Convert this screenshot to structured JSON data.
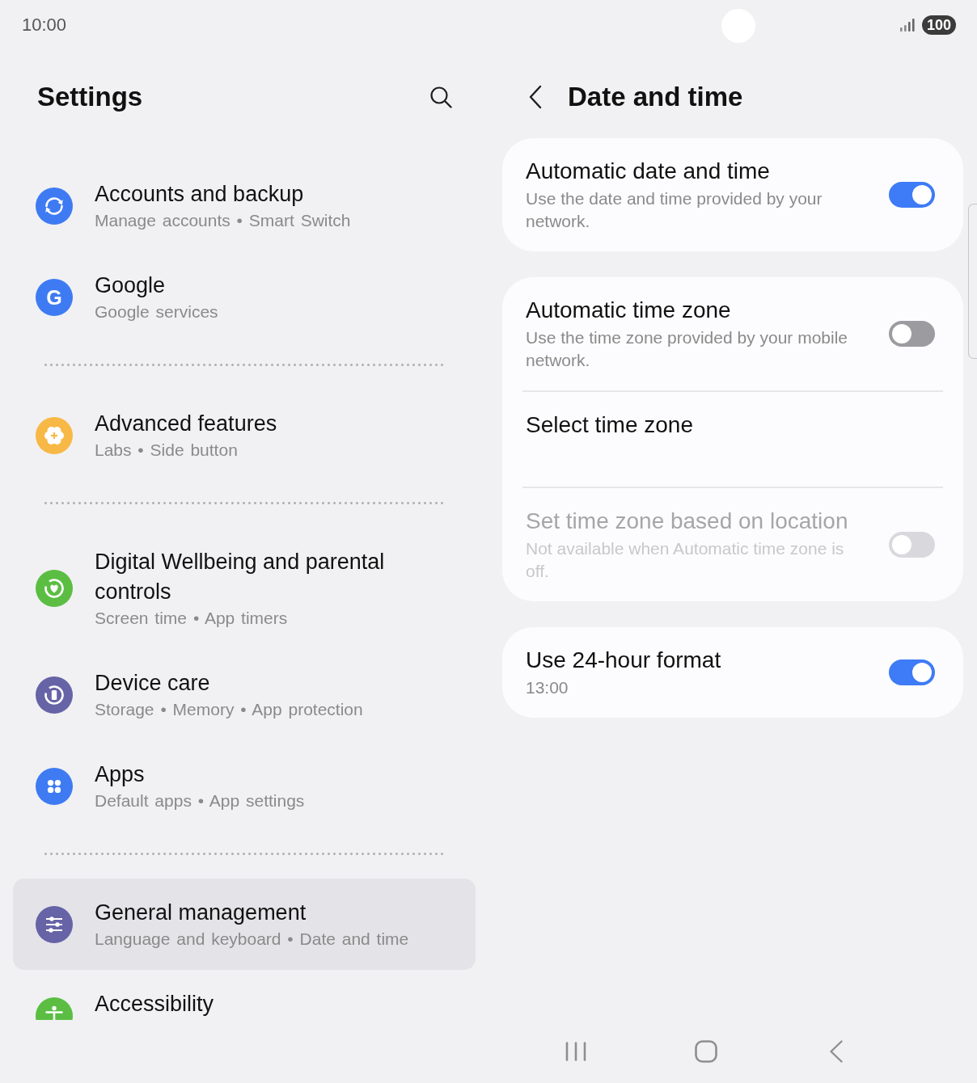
{
  "status_bar": {
    "time": "10:00",
    "battery": "100"
  },
  "settings_pane": {
    "title": "Settings",
    "groups": [
      {
        "items": [
          {
            "kind": "sync",
            "color": "#3e7bf3",
            "title": "Accounts and backup",
            "subtitle": "Manage accounts • Smart Switch",
            "selected": false
          },
          {
            "kind": "letter",
            "letter": "G",
            "color": "#3e7bf3",
            "title": "Google",
            "subtitle": "Google services",
            "selected": false
          }
        ]
      },
      {
        "items": [
          {
            "kind": "gear",
            "color": "#f8b846",
            "title": "Advanced features",
            "subtitle": "Labs • Side button",
            "selected": false
          }
        ]
      },
      {
        "items": [
          {
            "kind": "heart",
            "color": "#5bbe43",
            "title": "Digital Wellbeing and parental controls",
            "subtitle": "Screen time • App timers",
            "selected": false
          },
          {
            "kind": "phone",
            "color": "#6663a6",
            "title": "Device care",
            "subtitle": "Storage • Memory • App protection",
            "selected": false
          },
          {
            "kind": "dots",
            "color": "#3e7bf3",
            "title": "Apps",
            "subtitle": "Default apps • App settings",
            "selected": false
          }
        ]
      },
      {
        "items": [
          {
            "kind": "sliders",
            "color": "#6663a6",
            "title": "General management",
            "subtitle": "Language and keyboard • Date and time",
            "selected": true
          },
          {
            "kind": "person",
            "color": "#5bbe43",
            "title": "Accessibility",
            "selected": false
          }
        ]
      }
    ]
  },
  "detail_pane": {
    "title": "Date and time",
    "cards": [
      {
        "rows": [
          {
            "kind": "toggle",
            "title": "Automatic date and time",
            "subtitle": "Use the date and time provided by your network.",
            "on": true,
            "disabled": false
          }
        ]
      },
      {
        "rows": [
          {
            "kind": "toggle",
            "title": "Automatic time zone",
            "subtitle": "Use the time zone provided by your mobile network.",
            "on": false,
            "disabled": false
          },
          {
            "kind": "link",
            "title": "Select time zone",
            "disabled": false
          },
          {
            "kind": "toggle",
            "title": "Set time zone based on location",
            "subtitle": "Not available when Automatic time zone is off.",
            "on": false,
            "disabled": true
          }
        ]
      },
      {
        "rows": [
          {
            "kind": "toggle",
            "title": "Use 24-hour format",
            "subtitle": "13:00",
            "on": true,
            "disabled": false
          }
        ]
      }
    ]
  }
}
